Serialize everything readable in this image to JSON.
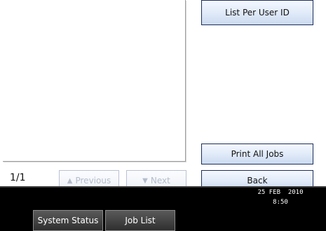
{
  "buttons": {
    "list_per_user": "List Per User ID",
    "print_all": "Print All Jobs",
    "back": "Back",
    "previous": "Previous",
    "next": "Next"
  },
  "pagination": {
    "page": "1/1"
  },
  "bottom_bar": {
    "system_status": "System Status",
    "job_list": "Job List",
    "date": "25 FEB  2010",
    "time": "8:50"
  }
}
